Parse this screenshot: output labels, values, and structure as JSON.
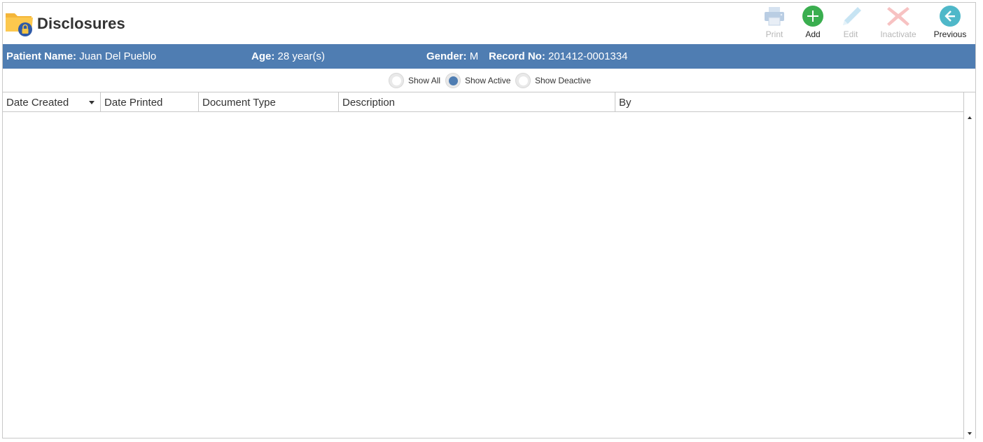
{
  "header": {
    "title": "Disclosures",
    "icon": "folder-lock-icon"
  },
  "toolbar": {
    "print": {
      "label": "Print",
      "icon": "printer-icon",
      "enabled": false
    },
    "add": {
      "label": "Add",
      "icon": "plus-circle-icon",
      "enabled": true
    },
    "edit": {
      "label": "Edit",
      "icon": "pencil-icon",
      "enabled": false
    },
    "inactivate": {
      "label": "Inactivate",
      "icon": "x-icon",
      "enabled": false
    },
    "previous": {
      "label": "Previous",
      "icon": "arrow-left-circle-icon",
      "enabled": true
    }
  },
  "patient": {
    "name_label": "Patient Name:",
    "name_value": "Juan Del Pueblo",
    "age_label": "Age:",
    "age_value": "28 year(s)",
    "gender_label": "Gender:",
    "gender_value": "M",
    "record_label": "Record No:",
    "record_value": "201412-0001334"
  },
  "filters": {
    "options": [
      {
        "label": "Show All",
        "checked": false
      },
      {
        "label": "Show Active",
        "checked": true
      },
      {
        "label": "Show Deactive",
        "checked": false
      }
    ]
  },
  "grid": {
    "columns": [
      "Date Created",
      "Date Printed",
      "Document Type",
      "Description",
      "By"
    ],
    "rows": []
  },
  "colors": {
    "accent": "#4f7db2",
    "add_green": "#3aae4f",
    "previous_teal": "#4fb8c9"
  }
}
